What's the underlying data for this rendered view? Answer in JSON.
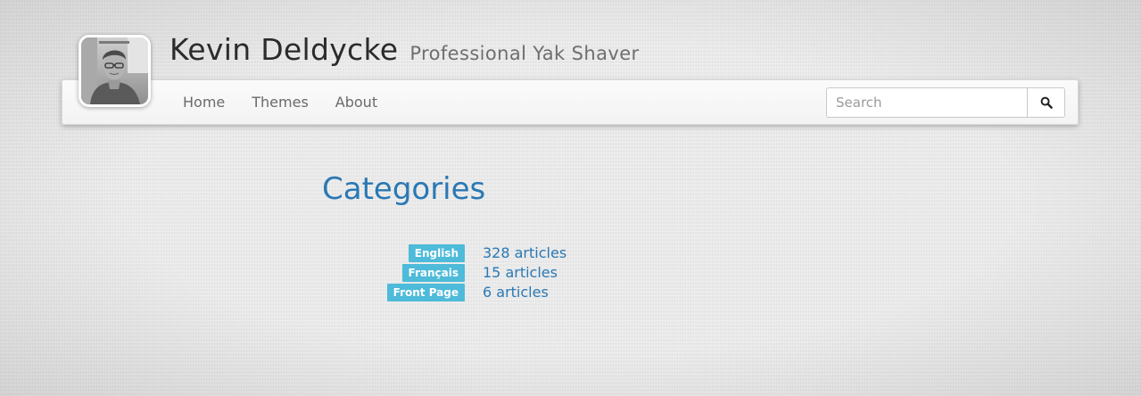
{
  "header": {
    "name": "Kevin Deldycke",
    "tagline": "Professional Yak Shaver"
  },
  "nav": {
    "items": [
      {
        "label": "Home"
      },
      {
        "label": "Themes"
      },
      {
        "label": "About"
      }
    ]
  },
  "search": {
    "placeholder": "Search",
    "value": "",
    "button_icon": "search-icon"
  },
  "main": {
    "title": "Categories",
    "categories": [
      {
        "badge": "English",
        "count": "328 articles"
      },
      {
        "badge": "Français",
        "count": "15 articles"
      },
      {
        "badge": "Front Page",
        "count": "6 articles"
      }
    ]
  },
  "colors": {
    "link": "#2a78b4",
    "badge": "#4dbbd9"
  }
}
